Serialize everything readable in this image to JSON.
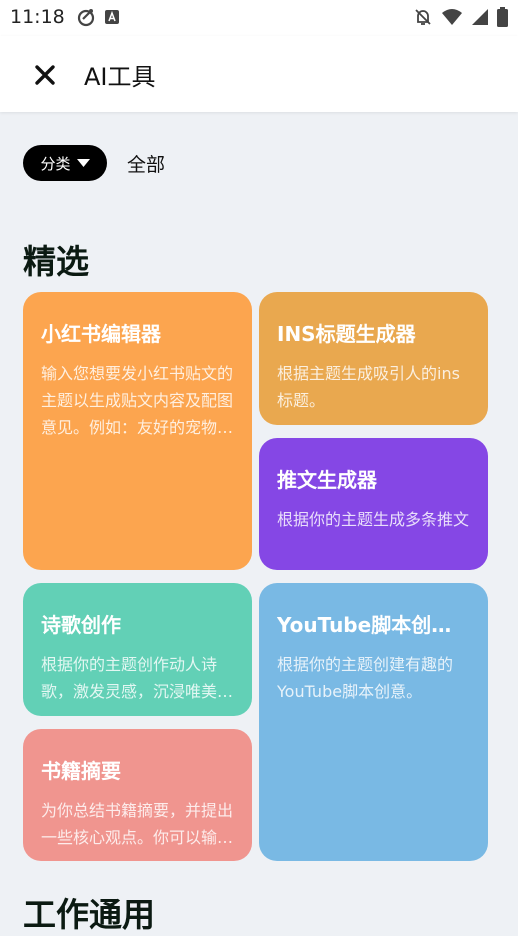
{
  "status_bar": {
    "time": "11:18",
    "icons_left": [
      "robot-vacuum-icon",
      "text-box-icon"
    ],
    "icons_right": [
      "notifications-off-icon",
      "wifi-icon",
      "signal-icon",
      "battery-icon"
    ]
  },
  "app_bar": {
    "close_icon": "close-icon",
    "title": "AI工具"
  },
  "filter": {
    "chip_label": "分类",
    "chip_icon": "caret-down-icon",
    "all_label": "全部"
  },
  "sections": {
    "featured": "精选",
    "work": "工作通用"
  },
  "cards": [
    {
      "title": "小红书编辑器",
      "desc": "输入您想要发小红书贴文的主题以生成贴文内容及配图意见。例如：友好的宠物店推荐",
      "color": "#fca54f"
    },
    {
      "title": "INS标题生成器",
      "desc": "根据主题生成吸引人的ins标题。",
      "color": "#e9a84f"
    },
    {
      "title": "推文生成器",
      "desc": "根据你的主题生成多条推文",
      "color": "#8547e5"
    },
    {
      "title": "诗歌创作",
      "desc": "根据你的主题创作动人诗歌，激发灵感，沉浸唯美意境",
      "color": "#62d0b6"
    },
    {
      "title": "YouTube脚本创作器",
      "desc": "根据你的主题创建有趣的YouTube脚本创意。",
      "color": "#79b9e4"
    },
    {
      "title": "书籍摘要",
      "desc": "为你总结书籍摘要，并提出一些核心观点。你可以输入书名",
      "color": "#f0958f"
    }
  ]
}
